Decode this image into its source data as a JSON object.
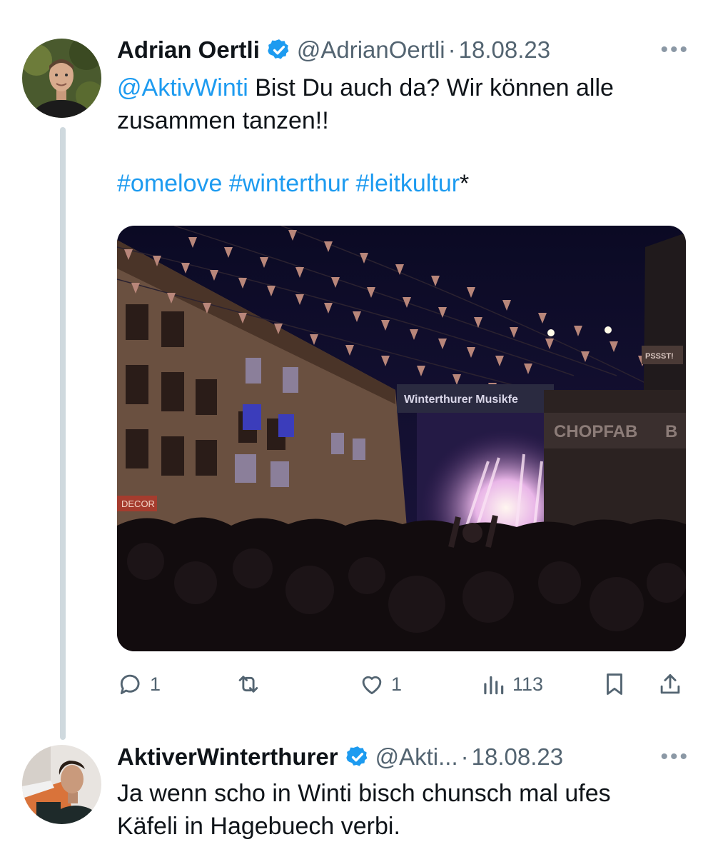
{
  "tweet1": {
    "author": "Adrian Oertli",
    "handle": "@AdrianOertli",
    "separator": "·",
    "date": "18.08.23",
    "more": "•••",
    "mention": "@AktivWinti",
    "text_part1": " Bist Du auch da? Wir können alle",
    "text_part2": "zusammen tanzen!!",
    "hashtag1": "#omelove",
    "hashtag2": "#winterthur",
    "hashtag3": "#leitkultur",
    "hashtag_suffix": "*",
    "image": {
      "banner_text": "Winterthurer Musikfe",
      "sign_text": "CHOPFAB",
      "sign_text_2": "B",
      "small_sign": "PSSST!",
      "shop_sign": "DECOR"
    },
    "actions": {
      "reply_count": "1",
      "like_count": "1",
      "views_count": "113"
    },
    "icons": [
      "verified-badge-icon",
      "reply-icon",
      "retweet-icon",
      "like-icon",
      "views-icon",
      "bookmark-icon",
      "share-icon"
    ]
  },
  "tweet2": {
    "author": "AktiverWinterthurer",
    "handle": "@Akti...",
    "separator": "·",
    "date": "18.08.23",
    "more": "•••",
    "text_line1": "Ja wenn scho in Winti bisch chunsch mal ufes",
    "text_line2": "Käfeli in Hagebuech verbi."
  },
  "colors": {
    "link": "#1d9bf0",
    "secondary_text": "#536471",
    "thread_line": "#cfd9de"
  }
}
